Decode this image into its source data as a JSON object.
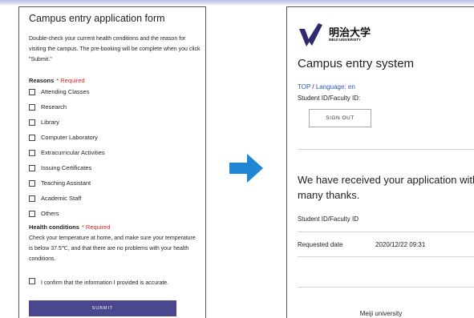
{
  "application_form": {
    "title": "Campus entry application form",
    "intro": "Double-check your current health conditions and the reason for visiting the campus. The pre-booking will be complete when you click \"Submit.\"",
    "reasons_label": "Reasons",
    "required_text": "* Required",
    "reasons": [
      "Attending Classes",
      "Research",
      "Library",
      "Computer Laboratory",
      "Extracurricular Activities",
      "Issuing Certificates",
      "Teaching Assistant",
      "Academic Staff",
      "Others"
    ],
    "health_label": "Health conditions",
    "health_text": "Check your temperature at home, and make sure your temperature is below 37.5℃, and that there are no problems with your health conditions.",
    "confirm_text": "I confirm that the information I provided is accurate.",
    "submit_label": "SUBMIT",
    "submit_color": "#4b4690"
  },
  "arrow": {
    "icon": "right-arrow-icon",
    "color": "#1f86d6"
  },
  "entry_system": {
    "logo_icon": "meiji-university-logo",
    "university_jp": "明治大学",
    "university_en": "MEIJI UNIVERSITY",
    "title": "Campus entry system",
    "breadcrumb_top": "TOP",
    "breadcrumb_sep": "/",
    "breadcrumb_language": "Language: en",
    "student_id_label": "Student ID/Faculty ID:",
    "signout_label": "SIGN OUT",
    "received_message": "We have received your application with many thanks.",
    "info_rows": [
      {
        "label": "Student ID/Faculty ID",
        "value": ""
      },
      {
        "label": "Requested date",
        "value": "2020/12/22 09:31"
      }
    ],
    "footer": "Meiji university",
    "link_color": "#2a55b8"
  }
}
